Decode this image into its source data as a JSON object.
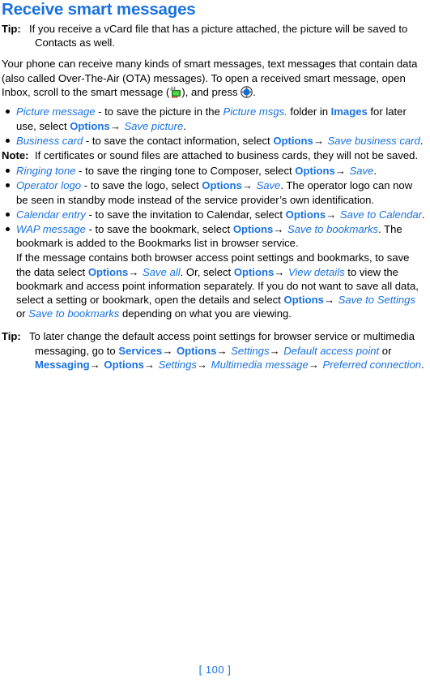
{
  "document": {
    "heading": "Receive smart messages",
    "page_number": "[ 100 ]",
    "accent_color": "#1a72e0",
    "text_color": "#000000"
  },
  "tip_top": {
    "label": "Tip:",
    "text": "If you receive a vCard file that has a picture attached, the picture will be saved to Contacts as well."
  },
  "intro": {
    "part1": "Your phone can receive many kinds of smart messages, text messages that contain data (also called Over-The-Air (OTA) messages). To open a received smart message, open Inbox, scroll to the smart message (",
    "part2": "), and press ",
    "part3": ".",
    "smart_message_icon": "smart-message-icon",
    "navi_key_icon": "navi-scroll-key-icon"
  },
  "bullets": [
    {
      "term": "Picture message",
      "dash": " - ",
      "seg1": "to save the picture in the ",
      "folder": "Picture msgs.",
      "seg2": " folder in ",
      "app": "Images",
      "seg3": " for later use, select ",
      "menu1": "Options",
      "arrow": "→",
      "menu2": "Save picture",
      "seg4": "."
    },
    {
      "term": "Business card",
      "dash": " - ",
      "seg1": "to save the contact information, select ",
      "menu1": "Options",
      "arrow": "→",
      "menu2": "Save business card",
      "seg4": "."
    },
    {
      "term": "Ringing tone",
      "dash": " - ",
      "seg1": "to save the ringing tone to Composer, select ",
      "menu1": "Options",
      "arrow": "→",
      "menu2": "Save",
      "seg4": "."
    },
    {
      "term": "Operator logo",
      "dash": " - ",
      "seg1": "to save the logo, select ",
      "menu1": "Options",
      "arrow": "→",
      "menu2": "Save",
      "seg4": ". The operator logo can now be seen in standby mode instead of the service provider’s own identification."
    },
    {
      "term": "Calendar entry",
      "dash": " - ",
      "seg1": "to save the invitation to Calendar, select ",
      "menu1": "Options",
      "arrow": "→",
      "menu2": "Save to Calendar",
      "seg4": "."
    },
    {
      "term": "WAP message",
      "dash": " - ",
      "seg1": "to save the bookmark, select ",
      "menu1": "Options",
      "arrow": "→",
      "menu2": "Save to bookmarks",
      "seg4": ". The bookmark is added to the Bookmarks list in browser service."
    }
  ],
  "note": {
    "label": "Note:",
    "text": "If certificates or sound files are attached to business cards, they will not be saved."
  },
  "wap_detail": {
    "seg1": "If the message contains both browser access point settings and bookmarks, to save the data select ",
    "menu1": "Options",
    "arrow1": "→",
    "menu2": "Save all",
    "seg2": ". Or, select ",
    "menu3": "Options",
    "arrow2": "→",
    "menu4": "View details",
    "seg3": " to view the bookmark and access point information separately. If you do not want to save all data, select a setting or bookmark, open the details and select ",
    "menu5": "Options",
    "arrow3": "→",
    "menu6": "Save to Settings",
    "seg4": " or ",
    "menu7": "Save to bookmarks",
    "seg5": " depending on what you are viewing."
  },
  "tip_bottom": {
    "label": "Tip:",
    "seg1": "To later change the default access point settings for browser service or multimedia messaging, go to ",
    "menu1": "Services",
    "arrow1": "→",
    "menu2": "Options",
    "arrow2": "→",
    "menu3": "Settings",
    "arrow3": "→",
    "menu4": "Default access point",
    "seg2": " or ",
    "menu5": "Messaging",
    "arrow4": "→",
    "menu6": "Options",
    "arrow5": "→",
    "menu7": "Settings",
    "arrow6": "→",
    "menu8": "Multimedia message",
    "arrow7": "→",
    "menu9": "Preferred connection",
    "seg3": "."
  }
}
